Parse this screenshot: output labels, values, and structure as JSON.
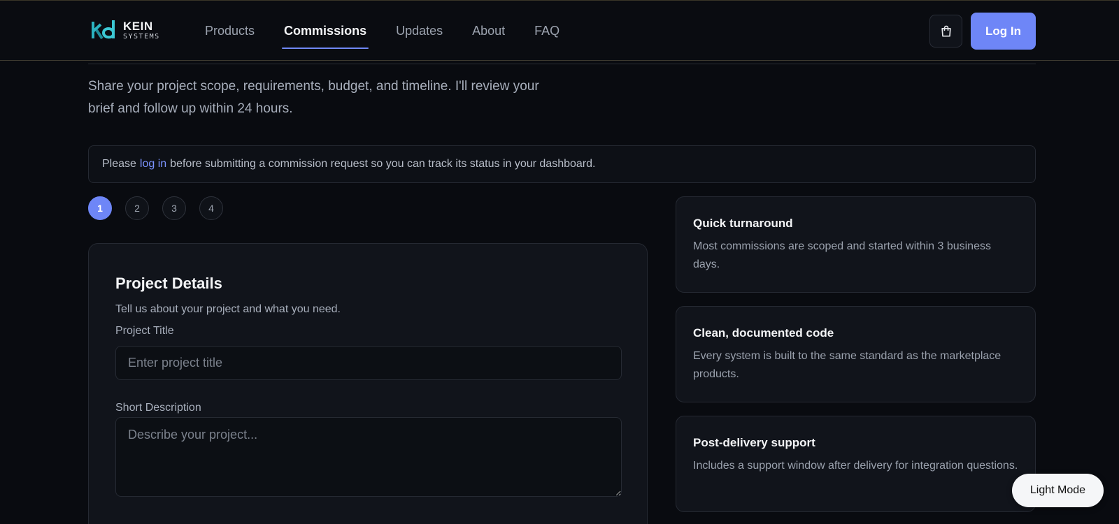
{
  "brand": {
    "name": "KEIN",
    "sub": "SYSTEMS",
    "accent": "#6e86f7"
  },
  "nav": {
    "items": [
      {
        "label": "Products"
      },
      {
        "label": "Commissions",
        "active": true
      },
      {
        "label": "Updates"
      },
      {
        "label": "About"
      },
      {
        "label": "FAQ"
      }
    ]
  },
  "header": {
    "cart_icon": "shopping-bag-icon",
    "login_label": "Log In"
  },
  "intro": "Share your project scope, requirements, budget, and timeline. I'll review your brief and follow up within 24 hours.",
  "notice": {
    "before": "Please",
    "link": "log in",
    "after": "before submitting a commission request so you can track its status in your dashboard."
  },
  "steps": [
    "1",
    "2",
    "3",
    "4"
  ],
  "form": {
    "title": "Project Details",
    "subtitle": "Tell us about your project and what you need.",
    "project_title_label": "Project Title",
    "project_title_placeholder": "Enter project title",
    "project_title_value": "",
    "description_label": "Short Description",
    "description_placeholder": "Describe your project...",
    "description_value": ""
  },
  "features": [
    {
      "title": "Quick turnaround",
      "desc": "Most commissions are scoped and started within 3 business days."
    },
    {
      "title": "Clean, documented code",
      "desc": "Every system is built to the same standard as the marketplace products."
    },
    {
      "title": "Post-delivery support",
      "desc": "Includes a support window after delivery for integration questions."
    }
  ],
  "mode_toggle_label": "Light Mode"
}
